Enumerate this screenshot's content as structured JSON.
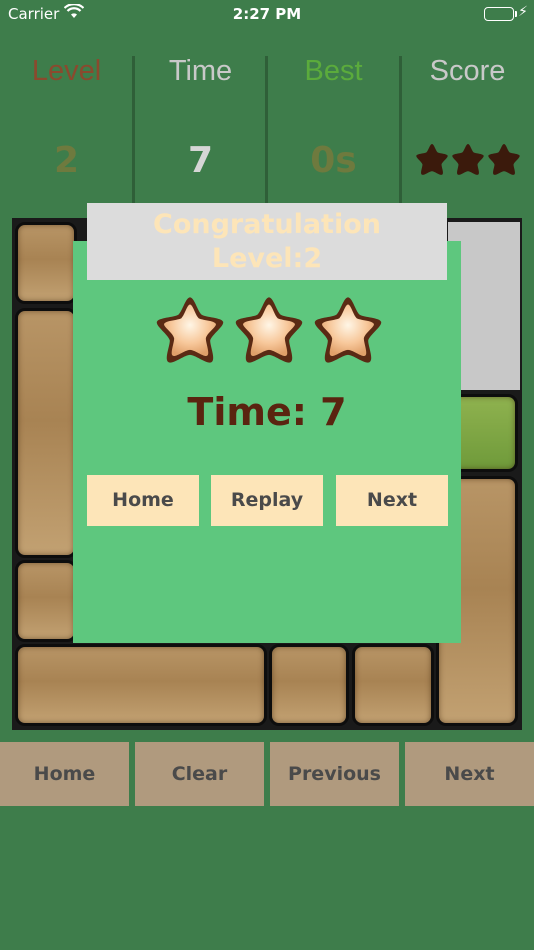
{
  "status_bar": {
    "carrier": "Carrier",
    "time": "2:27 PM"
  },
  "stats": [
    {
      "label": "Level",
      "value": "2",
      "label_color": "#8a4a2e",
      "value_color": "#6e7a3e"
    },
    {
      "label": "Time",
      "value": "7",
      "label_color": "#c9c9c9",
      "value_color": "#d6d6d6"
    },
    {
      "label": "Best",
      "value": "0s",
      "label_color": "#5bab3c",
      "value_color": "#6e7a3e"
    },
    {
      "label": "Score",
      "value": "",
      "label_color": "#c9c9c9",
      "value_color": "#3b1a0c"
    }
  ],
  "score_stars": 3,
  "dialog": {
    "title_line1": "Congratulation",
    "title_line2": "Level:2",
    "stars": 3,
    "time_text": "Time: 7",
    "buttons": {
      "home": "Home",
      "replay": "Replay",
      "next": "Next"
    }
  },
  "bottom_bar": {
    "home": "Home",
    "clear": "Clear",
    "previous": "Previous",
    "next": "Next"
  },
  "colors": {
    "background": "#3e7d4b",
    "dialog": "#5ec77e",
    "dialog_button": "#fde5b8",
    "bottom_button": "#b09a7e",
    "wood": "#a88353"
  }
}
